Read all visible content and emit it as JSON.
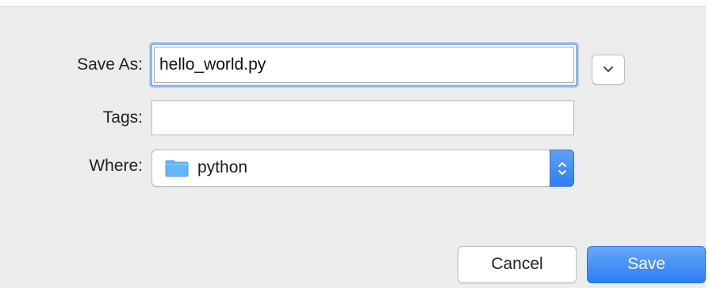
{
  "dialog": {
    "save_as_label": "Save As:",
    "filename_value": "hello_world.py",
    "tags_label": "Tags:",
    "tags_value": "",
    "where_label": "Where:",
    "where_value": "python",
    "where_icon": "folder-icon",
    "expand_icon": "chevron-down-icon",
    "stepper_icon": "up-down-arrows-icon",
    "cancel_label": "Cancel",
    "save_label": "Save"
  },
  "colors": {
    "dialog_background": "#ececec",
    "focus_ring": "#8fb7e8",
    "accent": "#2f7df3",
    "folder": "#5aaef6"
  }
}
